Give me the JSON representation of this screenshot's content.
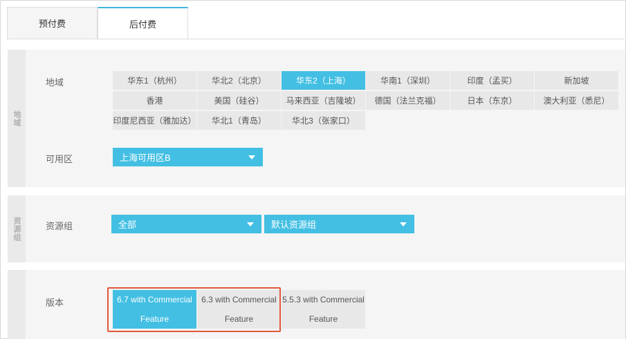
{
  "tabs": [
    {
      "label": "预付费",
      "active": false
    },
    {
      "label": "后付费",
      "active": true
    }
  ],
  "region_section": {
    "side_label": "地域",
    "region_label": "地域",
    "regions": [
      {
        "label": "华东1（杭州）",
        "active": false
      },
      {
        "label": "华北2（北京）",
        "active": false
      },
      {
        "label": "华东2（上海）",
        "active": true
      },
      {
        "label": "华南1（深圳）",
        "active": false
      },
      {
        "label": "印度（孟买）",
        "active": false
      },
      {
        "label": "新加坡",
        "active": false
      },
      {
        "label": "香港",
        "active": false
      },
      {
        "label": "美国（硅谷）",
        "active": false
      },
      {
        "label": "马来西亚（吉隆坡）",
        "active": false
      },
      {
        "label": "德国（法兰克福）",
        "active": false
      },
      {
        "label": "日本（东京）",
        "active": false
      },
      {
        "label": "澳大利亚（悉尼）",
        "active": false
      },
      {
        "label": "印度尼西亚（雅加达）",
        "active": false
      },
      {
        "label": "华北1（青岛）",
        "active": false
      },
      {
        "label": "华北3（张家口）",
        "active": false
      }
    ],
    "zone_label": "可用区",
    "zone_value": "上海可用区B"
  },
  "resource_section": {
    "side_label": "资源组",
    "label": "资源组",
    "scope_value": "全部",
    "group_value": "默认资源组"
  },
  "version_section": {
    "label": "版本",
    "versions": [
      {
        "line1": "6.7 with Commercial",
        "line2": "Feature",
        "active": true
      },
      {
        "line1": "6.3 with Commercial",
        "line2": "Feature",
        "active": false
      },
      {
        "line1": "5.5.3 with Commercial",
        "line2": "Feature",
        "active": false
      }
    ]
  },
  "colors": {
    "accent": "#43bfe3",
    "highlight_box": "#e0583a",
    "cell_bg": "#e8e8e8",
    "section_bg": "#f5f5f5"
  }
}
